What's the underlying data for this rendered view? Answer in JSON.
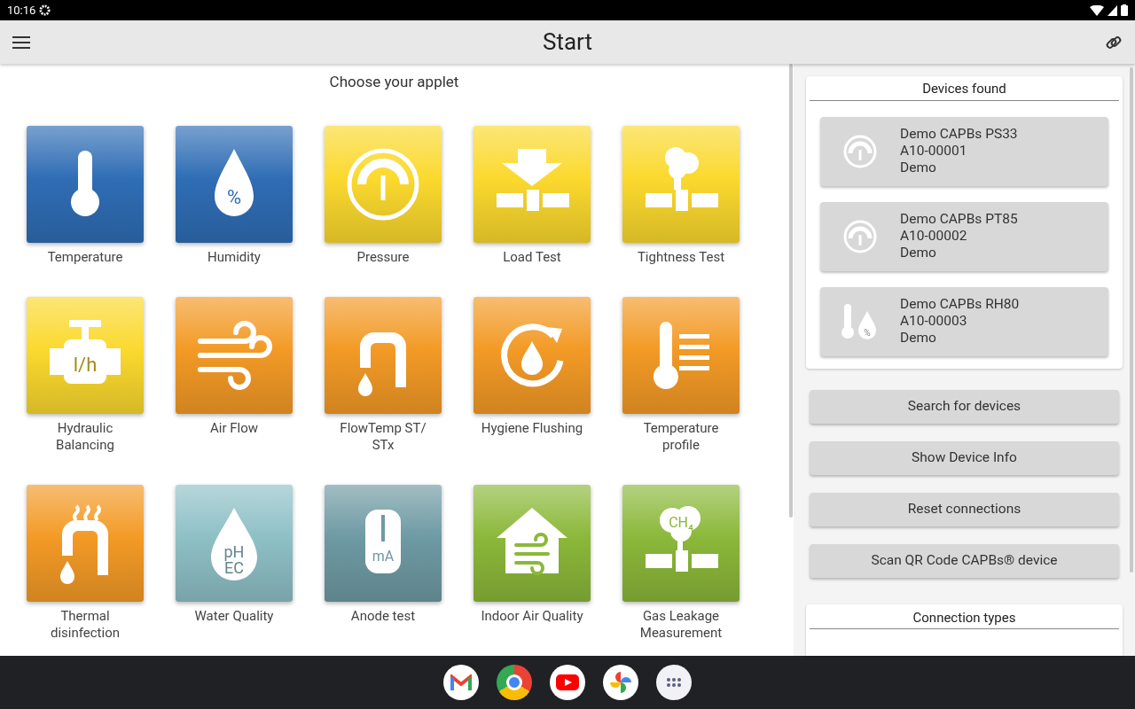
{
  "status_bar": {
    "time": "10:16"
  },
  "app_bar": {
    "title": "Start"
  },
  "applets": {
    "heading": "Choose your applet",
    "tiles": [
      {
        "label": "Temperature",
        "kind": "thermometer",
        "color": "#2f6db5"
      },
      {
        "label": "Humidity",
        "kind": "humidity",
        "color": "#2f6db5",
        "icon_text": [
          "%"
        ]
      },
      {
        "label": "Pressure",
        "kind": "gauge",
        "color": "#fbd92e"
      },
      {
        "label": "Load Test",
        "kind": "load",
        "color": "#fbd92e"
      },
      {
        "label": "Tightness Test",
        "kind": "smoke",
        "color": "#fbd92e"
      },
      {
        "label": "Hydraulic Balancing",
        "kind": "valve",
        "color": "#fbd92e",
        "icon_text": [
          "l/h"
        ]
      },
      {
        "label": "Air Flow",
        "kind": "wind",
        "color": "#f39a26"
      },
      {
        "label": "FlowTemp ST/ STx",
        "kind": "tap",
        "color": "#f39a26"
      },
      {
        "label": "Hygiene Flushing",
        "kind": "cycle",
        "color": "#f39a26"
      },
      {
        "label": "Temperature profile",
        "kind": "profile",
        "color": "#f39a26"
      },
      {
        "label": "Thermal disinfection",
        "kind": "hottap",
        "color": "#f39a26"
      },
      {
        "label": "Water Quality",
        "kind": "phdrop",
        "color": "#8ec0c6",
        "icon_text": [
          "pH",
          "EC"
        ]
      },
      {
        "label": "Anode test",
        "kind": "tank",
        "color": "#6e9aa3",
        "icon_text": [
          "mA"
        ]
      },
      {
        "label": "Indoor Air Quality",
        "kind": "house",
        "color": "#8bb83a"
      },
      {
        "label": "Gas Leakage Measurement",
        "kind": "gas",
        "color": "#8bb83a",
        "icon_text": [
          "CH₄"
        ]
      }
    ]
  },
  "devices": {
    "heading": "Devices found",
    "items": [
      {
        "name": "Demo CAPBs PS33",
        "serial": "A10-00001",
        "mode": "Demo",
        "kind": "gauge"
      },
      {
        "name": "Demo CAPBs PT85",
        "serial": "A10-00002",
        "mode": "Demo",
        "kind": "gauge"
      },
      {
        "name": "Demo CAPBs RH80",
        "serial": "A10-00003",
        "mode": "Demo",
        "kind": "thermo-humidity",
        "icon_text": [
          "%"
        ]
      }
    ]
  },
  "actions": [
    "Search for devices",
    "Show Device Info",
    "Reset connections",
    "Scan QR Code CAPBs® device"
  ],
  "connection_types": {
    "heading": "Connection types"
  }
}
